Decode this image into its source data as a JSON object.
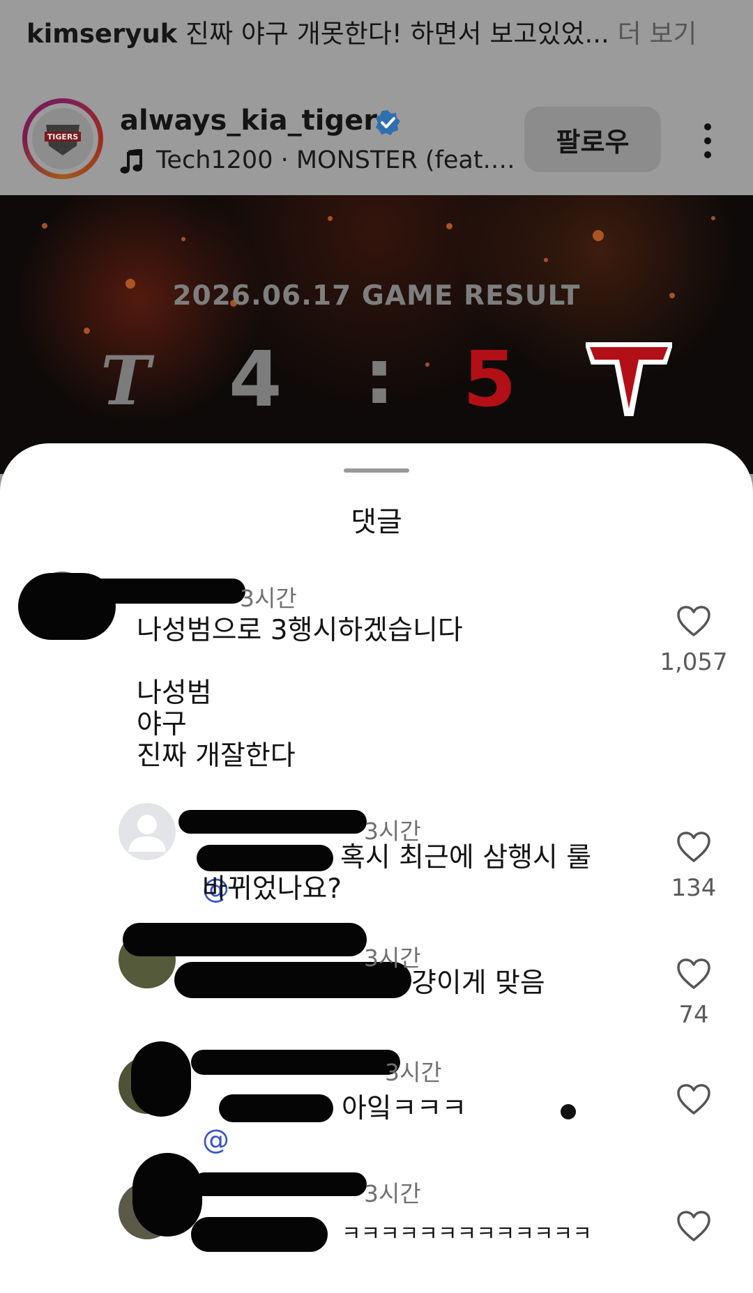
{
  "post": {
    "caption_user": "kimseryuk",
    "caption_text": " 진짜 야구 개못한다! 하면서 보고있었...",
    "caption_more": " 더 보기",
    "account": {
      "username": "always_kia_tigers",
      "logo_text": "TIGERS",
      "verified_icon": "verified-badge-icon",
      "music": "Tech1200 · MONSTER (feat.…",
      "music_icon": "music-note-icon"
    },
    "follow_label": "팔로우",
    "more_icon": "vertical-dots-icon"
  },
  "game": {
    "title": "2026.06.17 GAME RESULT",
    "away_logo": "T",
    "away_score": "4",
    "separator": ":",
    "home_score": "5",
    "home_logo": "T",
    "colors": {
      "home": "#b30f16",
      "away": "#7c7c7c"
    }
  },
  "sheet": {
    "title": "댓글",
    "comments": [
      {
        "time": "3시간",
        "text": "나성범으로 3행시하겠습니다\n\n나성범\n야구\n진짜 개잘한다",
        "likes": "1,057"
      },
      {
        "time": "3시간",
        "mention": "@",
        "text": "혹시 최근에 삼행시 룰\n바뀌었나요?",
        "likes": "134"
      },
      {
        "time": "3시간",
        "text": "걍이게 맞음",
        "likes": "74"
      },
      {
        "time": "3시간",
        "mention": "@",
        "text": "아잌ㅋㅋㅋ",
        "likes": ""
      },
      {
        "time": "3시간",
        "text": "ㅋㅋㅋㅋㅋㅋㅋㅋㅋㅋㅋㅋㅋ",
        "likes": ""
      }
    ]
  }
}
